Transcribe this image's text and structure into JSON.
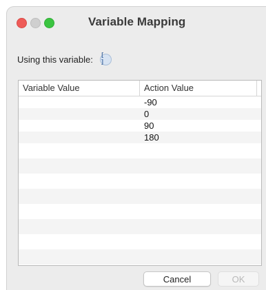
{
  "window": {
    "title": "Variable Mapping"
  },
  "variable": {
    "label": "Using this variable:",
    "icon": "variable-placeholder-icon",
    "icon_glyph": "[ ]"
  },
  "table": {
    "columns": [
      "Variable Value",
      "Action Value"
    ],
    "rows": [
      {
        "variable_value": "",
        "action_value": "-90"
      },
      {
        "variable_value": "",
        "action_value": "0"
      },
      {
        "variable_value": "",
        "action_value": "90"
      },
      {
        "variable_value": "",
        "action_value": "180"
      }
    ]
  },
  "buttons": {
    "cancel": "Cancel",
    "ok": "OK"
  },
  "colors": {
    "close": "#ee5b58",
    "minimize": "#cfcfcf",
    "zoom": "#3bc441"
  }
}
